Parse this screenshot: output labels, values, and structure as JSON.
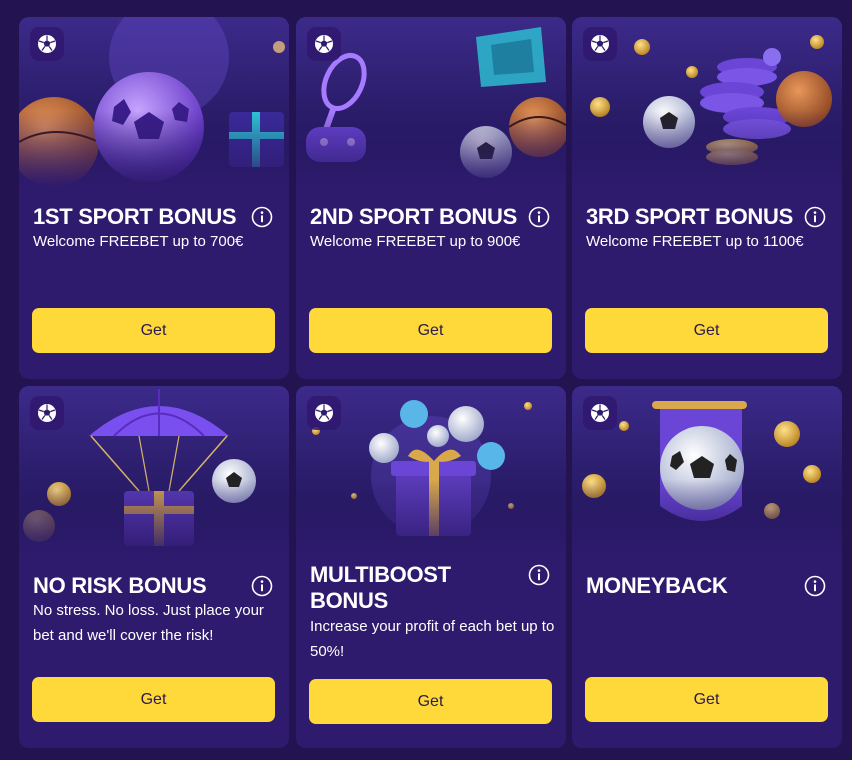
{
  "cards": [
    {
      "title": "1ST SPORT BONUS",
      "description": "Welcome FREEBET up to 700€",
      "button": "Get"
    },
    {
      "title": "2ND SPORT BONUS",
      "description": "Welcome FREEBET up to 900€",
      "button": "Get"
    },
    {
      "title": "3RD SPORT BONUS",
      "description": "Welcome FREEBET up to 1100€",
      "button": "Get"
    },
    {
      "title": "NO RISK BONUS",
      "description": "No stress. No loss. Just place your bet and we'll cover the risk!",
      "button": "Get"
    },
    {
      "title": "MULTIBOOST BONUS",
      "description": "Increase your profit of each bet up to 50%!",
      "button": "Get"
    },
    {
      "title": "MONEYBACK",
      "description": "",
      "button": "Get"
    }
  ],
  "icons": {
    "badge": "soccer-ball-icon",
    "info": "info-icon"
  },
  "colors": {
    "page_background": "#231451",
    "card_background": "#2e1b6e",
    "button_background": "#ffd83a",
    "button_text": "#2a1a4e",
    "text": "#ffffff"
  }
}
